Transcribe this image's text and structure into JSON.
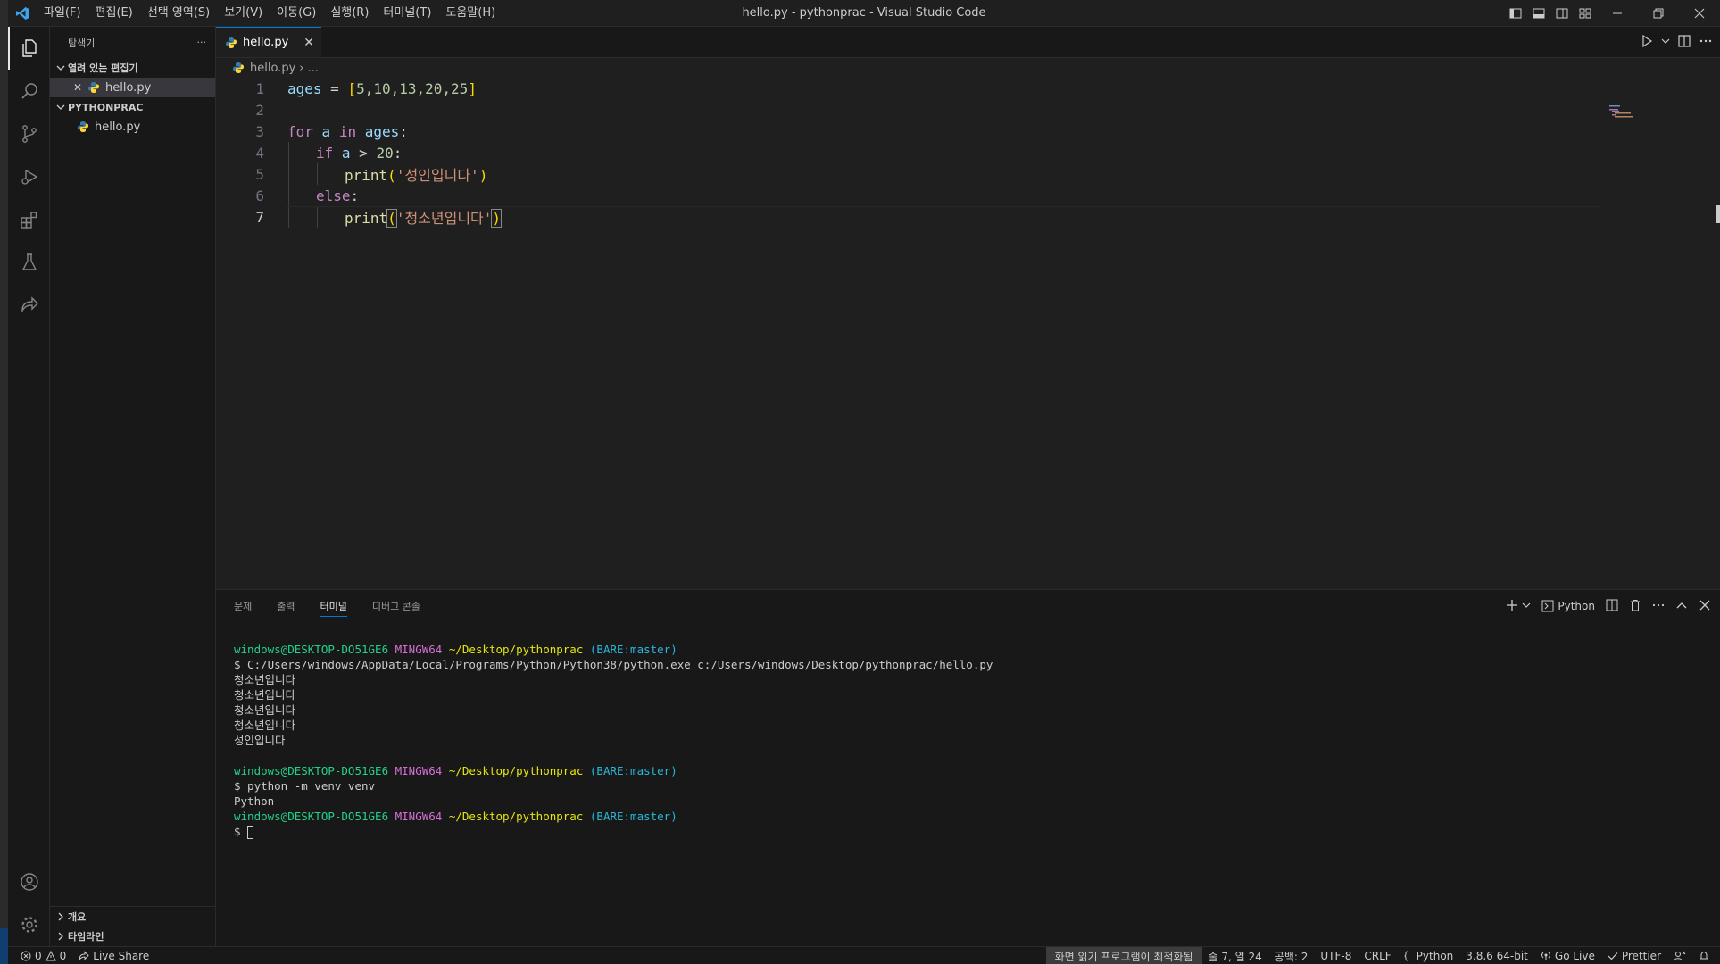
{
  "window": {
    "title": "hello.py - pythonprac - Visual Studio Code"
  },
  "menu": [
    "파일(F)",
    "편집(E)",
    "선택 영역(S)",
    "보기(V)",
    "이동(G)",
    "실행(R)",
    "터미널(T)",
    "도움말(H)"
  ],
  "sidebar": {
    "title": "탐색기",
    "more": "···",
    "open_editors_label": "열려 있는 편집기",
    "open_editors": [
      {
        "name": "hello.py",
        "close": "✕"
      }
    ],
    "folder_label": "PYTHONPRAC",
    "files": [
      {
        "name": "hello.py"
      }
    ],
    "outline_label": "개요",
    "timeline_label": "타임라인"
  },
  "editor": {
    "tab": {
      "label": "hello.py",
      "close": "✕"
    },
    "breadcrumb": {
      "file": "hello.py",
      "sep": "›",
      "rest": "..."
    },
    "line_numbers": [
      "1",
      "2",
      "3",
      "4",
      "5",
      "6",
      "7"
    ],
    "current_line": 7,
    "code": {
      "l1": {
        "var": "ages",
        "op": " = ",
        "open": "[",
        "nums": "5,10,13,20,25",
        "close": "]"
      },
      "l3": {
        "kw": "for",
        "sp1": " ",
        "var1": "a",
        "sp2": " ",
        "kw2": "in",
        "sp3": " ",
        "var2": "ages",
        "colon": ":"
      },
      "l4": {
        "kw": "if",
        "rest1": " ",
        "var": "a",
        "op": " > ",
        "num": "20",
        "colon": ":"
      },
      "l5": {
        "fn": "print",
        "open": "(",
        "str": "'성인입니다'",
        "close": ")"
      },
      "l6": {
        "kw": "else",
        "colon": ":"
      },
      "l7": {
        "fn": "print",
        "open": "(",
        "str": "'청소년입니다'",
        "close": ")"
      }
    }
  },
  "panel": {
    "tabs": [
      "문제",
      "출력",
      "터미널",
      "디버그 콘솔"
    ],
    "active_tab": "터미널",
    "shell_label": "Python",
    "terminal": {
      "prompt_user": "windows@DESKTOP-DO51GE6",
      "prompt_sys": "MINGW64",
      "prompt_path": "~/Desktop/pythonprac",
      "prompt_branch": "(BARE:master)",
      "cmd1": "$ C:/Users/windows/AppData/Local/Programs/Python/Python38/python.exe c:/Users/windows/Desktop/pythonprac/hello.py",
      "outputs": [
        "청소년입니다",
        "청소년입니다",
        "청소년입니다",
        "청소년입니다",
        "성인입니다"
      ],
      "cmd2": "$ python -m venv venv",
      "cmd2_output": "Python",
      "prompt_symbol": "$ "
    }
  },
  "statusbar": {
    "errors": "0",
    "warnings": "0",
    "live_share": "Live Share",
    "screen_reader": "화면 읽기 프로그램이 최적화됨",
    "position": "줄 7, 열 24",
    "spaces": "공백: 2",
    "encoding": "UTF-8",
    "eol": "CRLF",
    "language": "Python",
    "interpreter": "3.8.6 64-bit",
    "go_live": "Go Live",
    "prettier": "Prettier"
  },
  "colors": {
    "accent": "#0078d4",
    "editor_bg": "#1f1f1f",
    "sidebar_bg": "#181818"
  }
}
